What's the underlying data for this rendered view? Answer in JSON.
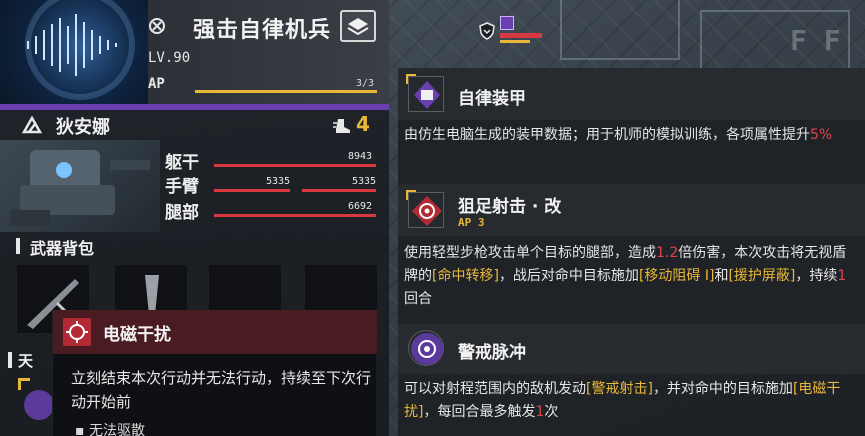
{
  "unit": {
    "mech_name": "强击自律机兵",
    "level": "LV.90",
    "ap_label": "AP",
    "ap_count": "3/3",
    "ap_fraction": 1.0,
    "pilot_name": "狄安娜",
    "move_value": "4",
    "parts": [
      {
        "name": "躯干",
        "value": "8943",
        "fraction": 1.0
      },
      {
        "name": "手臂",
        "left_value": "5335",
        "right_value": "5335",
        "fraction": 1.0
      },
      {
        "name": "腿部",
        "value": "6692",
        "fraction": 1.0
      }
    ],
    "weapon_section_title": "武器背包",
    "sub_section_title": "天"
  },
  "popup": {
    "title": "电磁干扰",
    "desc": "立刻结束本次行动并无法行动，持续至下次行动开始前",
    "bullet": "▪ 无法驱散"
  },
  "skills": [
    {
      "name": "自律装甲",
      "desc_parts": [
        "由仿生电脑生成的装甲数据；用于机师的模拟训练，各项属性提升",
        "5%"
      ]
    },
    {
      "name": "狙足射击 · 改",
      "ap": "AP 3",
      "desc_parts": [
        "使用轻型步枪攻击单个目标的腿部，造成",
        "1.2",
        "倍伤害，本次攻击将无视盾牌的",
        "[命中转移]",
        "，战后对命中目标施加",
        "[移动阻碍 Ⅰ]",
        "和",
        "[援护屏蔽]",
        "，持续",
        "1",
        "回合"
      ]
    },
    {
      "name": "警戒脉冲",
      "desc_parts": [
        "可以对射程范围内的敌机发动",
        "[警戒射击]",
        "，并对命中的目标施加",
        "[电磁干扰]",
        "，每回合最多触发",
        "1",
        "次"
      ]
    }
  ],
  "colors": {
    "accent_purple": "#6a3fb0",
    "hp_red": "#d8383f",
    "gold": "#e8b938",
    "highlight_red": "#e0454c"
  }
}
